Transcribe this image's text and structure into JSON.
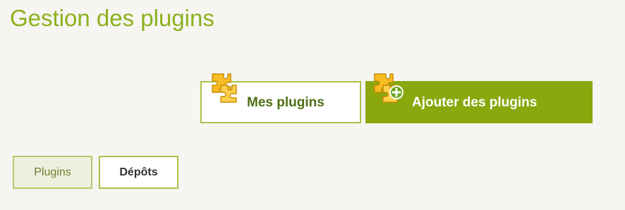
{
  "page": {
    "title": "Gestion des plugins"
  },
  "main_tabs": [
    {
      "label": "Mes plugins",
      "icon": "puzzle-icon",
      "selected": false
    },
    {
      "label": "Ajouter des plugins",
      "icon": "puzzle-add-icon",
      "selected": true
    }
  ],
  "sub_tabs": [
    {
      "label": "Plugins",
      "selected": true
    },
    {
      "label": "Dépôts",
      "selected": false
    }
  ],
  "colors": {
    "background": "#f6f5f2",
    "title": "#8cb11c",
    "accent": "#8aa70e",
    "tab_border": "#a7c24a",
    "puzzle_fill": "#f7b81e"
  }
}
